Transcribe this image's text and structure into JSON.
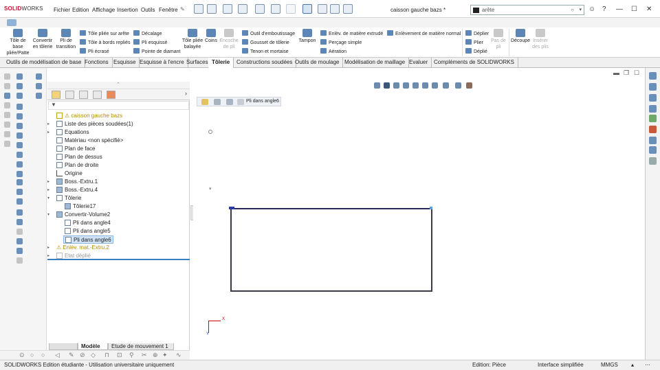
{
  "app": {
    "logo": "SOLIDWORKS",
    "logo_prefix": "SOLID",
    "logo_suffix": "WORKS",
    "doc_title": "caisson gauche bazs *"
  },
  "menu": [
    "Fichier",
    "Edition",
    "Affichage",
    "Insertion",
    "Outils",
    "Fenêtre"
  ],
  "search": {
    "value": "arête"
  },
  "ribbon": {
    "big": [
      {
        "label": "Tôle de base pliée/Patte",
        "disabled": false
      },
      {
        "label": "Convertir en tôlerie",
        "disabled": false
      },
      {
        "label": "Pli de transition",
        "disabled": false
      },
      {
        "label": "Tôle pliée balayée",
        "disabled": false
      },
      {
        "label": "Coins",
        "disabled": false
      },
      {
        "label": "Encoche de pli",
        "disabled": true
      },
      {
        "label": "Tampon",
        "disabled": false
      },
      {
        "label": "Découpe",
        "disabled": false
      },
      {
        "label": "Insérer des plis",
        "disabled": true
      },
      {
        "label": "Pas de pli",
        "disabled": true
      }
    ],
    "small": [
      {
        "label": "Tôle pliée sur arête",
        "disabled": false
      },
      {
        "label": "Tôle à bords repliés",
        "disabled": false
      },
      {
        "label": "Pli écrasé",
        "disabled": false
      },
      {
        "label": "Décalage",
        "disabled": false
      },
      {
        "label": "Pli esquissé",
        "disabled": false
      },
      {
        "label": "Pointe de diamant",
        "disabled": false
      },
      {
        "label": "Outil d'emboutissage",
        "disabled": false
      },
      {
        "label": "Gousset de tôlerie",
        "disabled": false
      },
      {
        "label": "Tenon et mortaise",
        "disabled": false
      },
      {
        "label": "Enlèv. de matière extrudé",
        "disabled": false
      },
      {
        "label": "Perçage simple",
        "disabled": false
      },
      {
        "label": "Aération",
        "disabled": false
      },
      {
        "label": "Enlèvement de matière normal",
        "disabled": false
      },
      {
        "label": "Déplier",
        "disabled": false
      },
      {
        "label": "Plier",
        "disabled": false
      },
      {
        "label": "Déplié",
        "disabled": false
      }
    ]
  },
  "tabs": [
    {
      "label": "Outils de modélisation de base",
      "active": false
    },
    {
      "label": "Fonctions",
      "active": false
    },
    {
      "label": "Esquisse",
      "active": false
    },
    {
      "label": "Esquisse à l'encre",
      "active": false
    },
    {
      "label": "Surfaces",
      "active": false
    },
    {
      "label": "Tôlerie",
      "active": true
    },
    {
      "label": "Constructions soudées",
      "active": false
    },
    {
      "label": "Outils de moulage",
      "active": false
    },
    {
      "label": "Modélisation de maillage",
      "active": false
    },
    {
      "label": "Evaluer",
      "active": false
    },
    {
      "label": "Compléments de SOLIDWORKS",
      "active": false
    }
  ],
  "tree": [
    {
      "label": "caisson gauche bazs",
      "style": "warn",
      "arrow": ""
    },
    {
      "label": "Liste des pièces soudées(1)",
      "style": "",
      "arrow": "▸"
    },
    {
      "label": "Equations",
      "style": "",
      "arrow": "▸"
    },
    {
      "label": "Matériau <non spécifié>",
      "style": "",
      "arrow": ""
    },
    {
      "label": "Plan de face",
      "style": "",
      "arrow": ""
    },
    {
      "label": "Plan de dessus",
      "style": "",
      "arrow": ""
    },
    {
      "label": "Plan de droite",
      "style": "",
      "arrow": ""
    },
    {
      "label": "Origine",
      "style": "",
      "arrow": ""
    },
    {
      "label": "Boss.-Extru.1",
      "style": "",
      "arrow": "▸"
    },
    {
      "label": "Boss.-Extru.4",
      "style": "",
      "arrow": "▸"
    },
    {
      "label": "Tôlerie",
      "style": "",
      "arrow": "▾"
    },
    {
      "label": "Tôlerie17",
      "style": "",
      "arrow": ""
    },
    {
      "label": "Convertir-Volume2",
      "style": "",
      "arrow": "▾"
    },
    {
      "label": "Pli dans angle4",
      "style": "",
      "arrow": ""
    },
    {
      "label": "Pli dans angle5",
      "style": "",
      "arrow": ""
    },
    {
      "label": "Pli dans angle6",
      "style": "sel",
      "arrow": ""
    },
    {
      "label": "Enlèv. mat.-Extru.2",
      "style": "warn",
      "arrow": "▸"
    },
    {
      "label": "Etat déplié",
      "style": "gray",
      "arrow": "▸"
    }
  ],
  "breadcrumb": {
    "label": "Pli dans angle6"
  },
  "bottom_tabs": [
    {
      "label": "Modèle",
      "active": true
    },
    {
      "label": "Etude de mouvement 1",
      "active": false
    }
  ],
  "status": {
    "edition": "SOLIDWORKS Edition étudiante - Utilisation universitaire uniquement",
    "mode": "Edition: Pièce",
    "interface": "Interface simplifiée",
    "units": "MMGS"
  },
  "axes": {
    "x": "X",
    "y": "Y"
  },
  "colors": {
    "logo": "#c8102e",
    "selection": "#cfe2f6",
    "accent": "#3a7ec2",
    "sketch": "#3a3a44",
    "origin_x": "#cc0000",
    "origin_y": "#2a3aa8"
  }
}
